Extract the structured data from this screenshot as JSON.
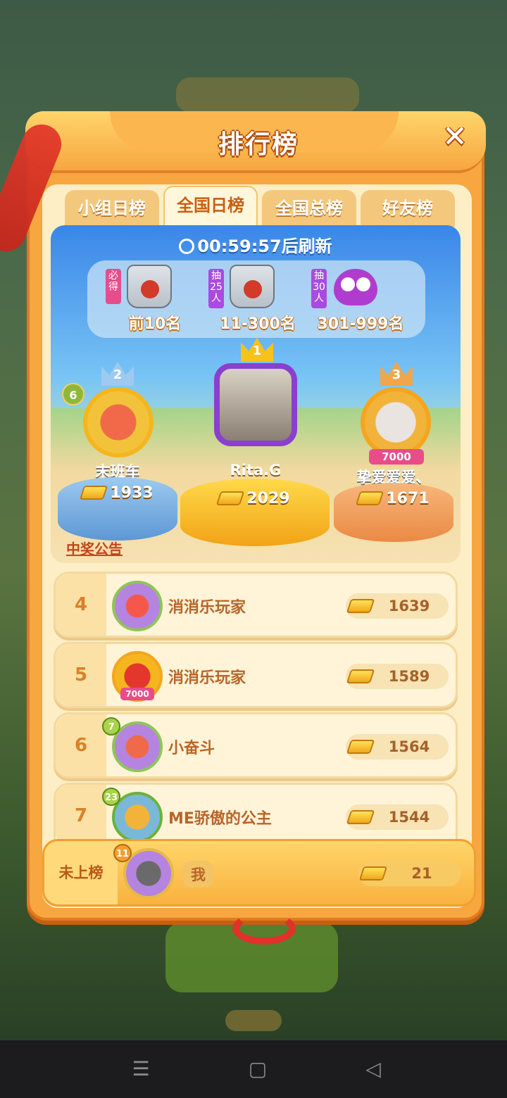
{
  "title": "排行榜",
  "tabs": [
    {
      "label": "小组日榜",
      "active": false
    },
    {
      "label": "全国日榜",
      "active": true
    },
    {
      "label": "全国总榜",
      "active": false
    },
    {
      "label": "好友榜",
      "active": false
    }
  ],
  "timer": {
    "time": "00:59:57",
    "suffix": "后刷新"
  },
  "prizes": [
    {
      "badge": "必得",
      "label": "前10名",
      "icon": "gift-bag-icon"
    },
    {
      "badge": "抽25人",
      "label": "11-300名",
      "icon": "gift-bag-icon"
    },
    {
      "badge": "抽30人",
      "label": "301-999名",
      "icon": "owl-plush-icon"
    }
  ],
  "podium": {
    "first": {
      "rank": "1",
      "name": "Rita.G",
      "score": "2029"
    },
    "second": {
      "rank": "2",
      "name": "末班车",
      "score": "1933",
      "level": "6"
    },
    "third": {
      "rank": "3",
      "name": "挚爱爱爱、",
      "score": "1671",
      "frame_label": "7000"
    }
  },
  "notice_link": "中奖公告",
  "rows": [
    {
      "rank": "4",
      "name": "消消乐玩家",
      "score": "1639"
    },
    {
      "rank": "5",
      "name": "消消乐玩家",
      "score": "1589",
      "frame_label": "7000"
    },
    {
      "rank": "6",
      "name": "小奋斗",
      "score": "1564",
      "level": "7"
    },
    {
      "rank": "7",
      "name": "ME骄傲的公主",
      "score": "1544",
      "level": "23"
    }
  ],
  "me": {
    "rank_label": "未上榜",
    "name": "我",
    "score": "21",
    "level": "11"
  },
  "nav": {
    "menu": "☰",
    "home": "▢",
    "back": "◁"
  },
  "colors": {
    "accent": "#f7a640",
    "gold": "#ffd56a",
    "sky": "#3a86e8"
  }
}
